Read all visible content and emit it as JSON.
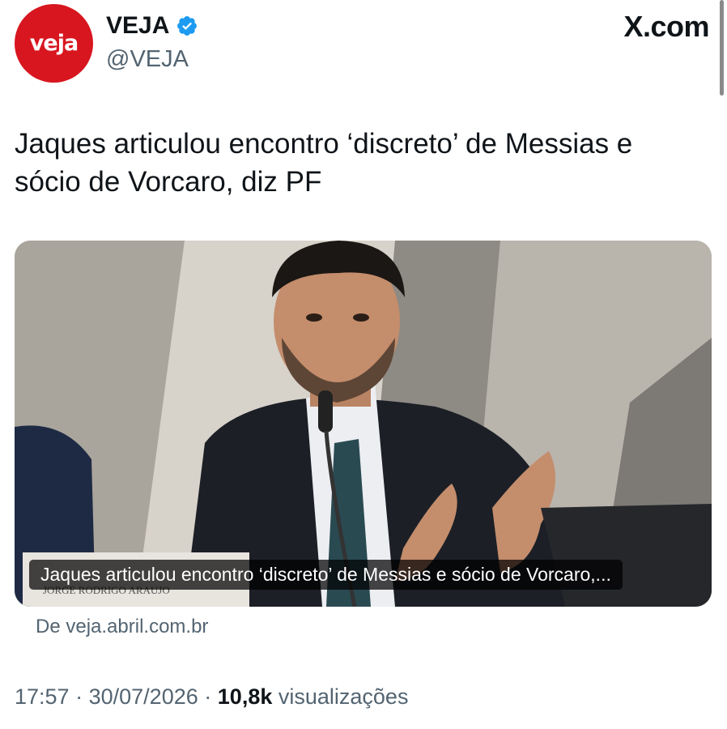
{
  "account": {
    "avatar_text": "veja",
    "display_name": "VEJA",
    "handle": "@VEJA",
    "verified": true
  },
  "site_label": "X.com",
  "tweet": {
    "text_line1": "Jaques articulou encontro ‘discreto’ de Messias e",
    "text_line2": "sócio de Vorcaro, diz PF"
  },
  "card": {
    "caption": "Jaques articulou encontro ‘discreto’ de Messias e sócio de Vorcaro,...",
    "nameplate_text": "JORGE RODRIGO ARAUJO",
    "source": "De veja.abril.com.br"
  },
  "meta": {
    "time": "17:57",
    "separator": "·",
    "date": "30/07/2026",
    "views_count": "10,8k",
    "views_label": "visualizações"
  },
  "colors": {
    "brand_red": "#d8161f",
    "verified_blue": "#1d9bf0",
    "secondary_text": "#536471"
  }
}
